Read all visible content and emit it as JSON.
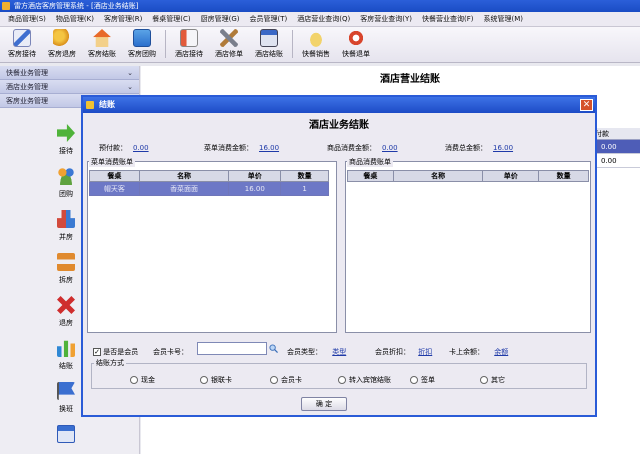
{
  "window": {
    "title": "雷方酒店客房管理系统 - [酒店业务结账]"
  },
  "menu": [
    "商品管理(S)",
    "物品管理(K)",
    "客房管理(R)",
    "餐桌管理(C)",
    "厨房管理(G)",
    "会员管理(T)",
    "酒店营业查询(Q)",
    "客房营业查询(Y)",
    "快餐营业查询(F)",
    "系统管理(M)"
  ],
  "toolbar": {
    "buttons": [
      {
        "label": "客房接待",
        "icon": "pencil-form-icon"
      },
      {
        "label": "客房退房",
        "icon": "key-icon"
      },
      {
        "label": "客房结账",
        "icon": "house-icon"
      },
      {
        "label": "客房团购",
        "icon": "blue-form-icon"
      },
      {
        "label": "酒店接待",
        "icon": "id-card-icon"
      },
      {
        "label": "酒店修单",
        "icon": "tools-icon"
      },
      {
        "label": "酒店结账",
        "icon": "calculator-icon"
      },
      {
        "label": "快餐销售",
        "icon": "fast-food-icon"
      },
      {
        "label": "快餐退单",
        "icon": "refund-icon"
      }
    ]
  },
  "sidebar": {
    "headers": [
      "快餐业务管理",
      "酒店业务管理",
      "客房业务管理"
    ],
    "items": [
      {
        "label": "接待",
        "icon": "arrow-right-icon",
        "color": "#4fb33a"
      },
      {
        "label": "团购",
        "icon": "group-people-icon",
        "color": "#f0a132"
      },
      {
        "label": "并房",
        "icon": "cubes-icon",
        "color": "#d24a3c"
      },
      {
        "label": "拆房",
        "icon": "org-chart-icon",
        "color": "#e08a2e"
      },
      {
        "label": "退房",
        "icon": "red-x-icon",
        "color": "#cf2e2e"
      },
      {
        "label": "结账",
        "icon": "bar-chart-icon",
        "color": "#2f88d4"
      },
      {
        "label": "换班",
        "icon": "flag-icon",
        "color": "#3a6fd0"
      }
    ]
  },
  "main": {
    "title": "酒店营业结账",
    "grid": {
      "header": "付款",
      "rows": [
        "0.00",
        "0.00"
      ]
    }
  },
  "dialog": {
    "title": "结账",
    "heading": "酒店业务结账",
    "summary": {
      "prepaid_label": "预付款：",
      "prepaid_value": "0.00",
      "dish_label": "菜单消费金额：",
      "dish_value": "16.00",
      "goods_label": "商品消费金额：",
      "goods_value": "0.00",
      "total_label": "消费总金额：",
      "total_value": "16.00"
    },
    "dish_table": {
      "caption": "菜单消费账单",
      "columns": [
        "餐桌",
        "名称",
        "单价",
        "数量"
      ],
      "rows": [
        [
          "帽天客",
          "香菜面面",
          "16.00",
          "1"
        ]
      ]
    },
    "goods_table": {
      "caption": "商品消费账单",
      "columns": [
        "餐桌",
        "名称",
        "单价",
        "数量"
      ],
      "rows": []
    },
    "member": {
      "is_member_label": "是否是会员",
      "checked": true,
      "card_label": "会员卡号：",
      "card_value": "",
      "type_label": "会员类型：",
      "type_value": "类型",
      "discount_label": "会员折扣：",
      "discount_value": "折扣",
      "balance_label": "卡上余额：",
      "balance_value": "余额"
    },
    "payment": {
      "caption": "结账方式",
      "options": [
        "现金",
        "银联卡",
        "会员卡",
        "转入宾馆结账",
        "签单",
        "其它"
      ]
    },
    "confirm_label": "确 定"
  }
}
